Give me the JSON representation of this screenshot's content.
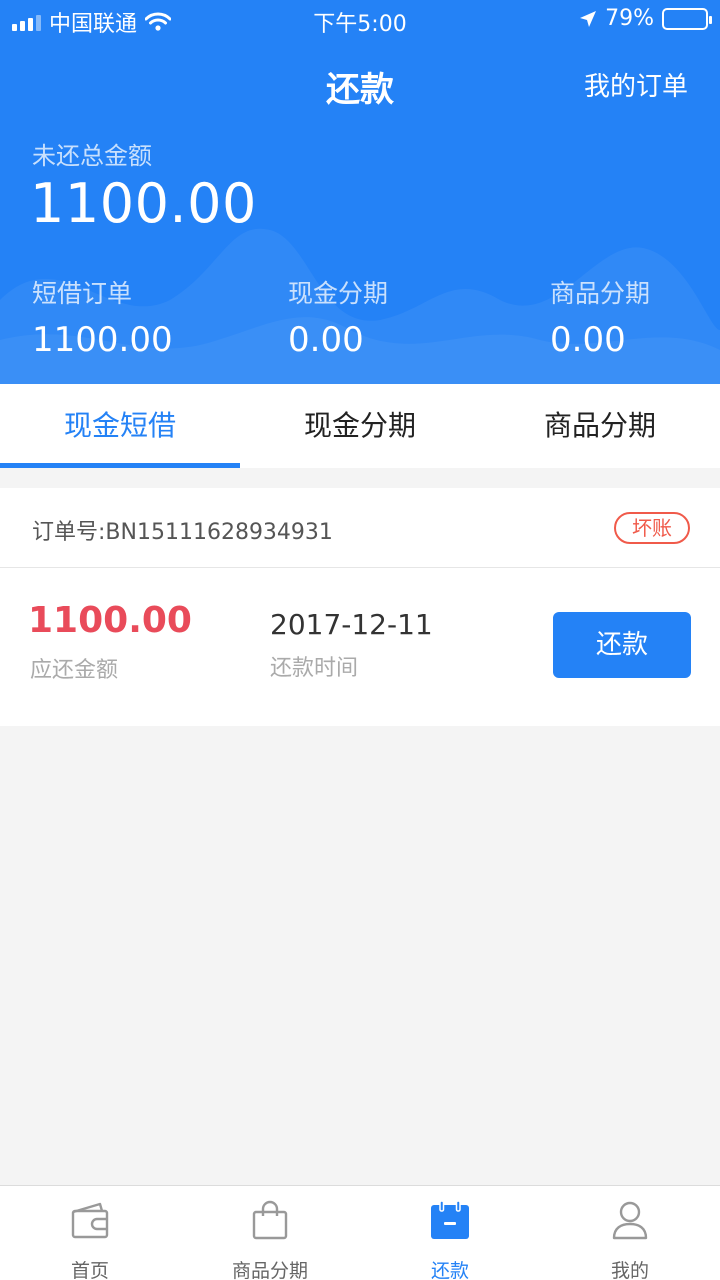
{
  "status_bar": {
    "carrier": "中国联通",
    "time": "下午5:00",
    "battery": "79%",
    "battery_level": 0.79,
    "icons": [
      "signal-icon",
      "wifi-icon",
      "location-arrow-icon",
      "battery-icon"
    ]
  },
  "nav": {
    "title": "还款",
    "my_orders": "我的订单"
  },
  "summary": {
    "total_label": "未还总金额",
    "total_value": "1100.00",
    "items": [
      {
        "label": "短借订单",
        "value": "1100.00"
      },
      {
        "label": "现金分期",
        "value": "0.00"
      },
      {
        "label": "商品分期",
        "value": "0.00"
      }
    ]
  },
  "tabs": [
    {
      "label": "现金短借",
      "active": true
    },
    {
      "label": "现金分期",
      "active": false
    },
    {
      "label": "商品分期",
      "active": false
    }
  ],
  "order": {
    "order_no": "订单号:BN15111628934931",
    "status_badge": "坏账",
    "amount": "1100.00",
    "amount_label": "应还金额",
    "date": "2017-12-11",
    "date_label": "还款时间",
    "repay_button": "还款"
  },
  "tabbar": [
    {
      "label": "首页",
      "icon": "wallet-icon",
      "active": false
    },
    {
      "label": "商品分期",
      "icon": "shopping-bag-icon",
      "active": false
    },
    {
      "label": "还款",
      "icon": "calendar-icon",
      "active": true
    },
    {
      "label": "我的",
      "icon": "user-icon",
      "active": false
    }
  ],
  "colors": {
    "primary": "#2482f6",
    "amount_red": "#e94b5a",
    "badge_red": "#f05a4a",
    "background": "#f4f4f4"
  }
}
